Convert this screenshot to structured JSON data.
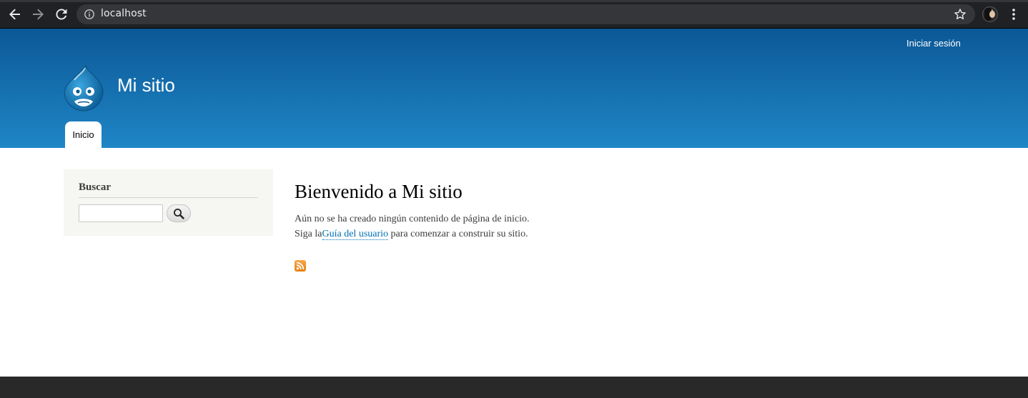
{
  "browser": {
    "url": "localhost",
    "icons": {
      "back": "back-arrow-icon",
      "forward": "forward-arrow-icon",
      "reload": "reload-icon",
      "info": "info-icon",
      "bookmark": "star-icon",
      "menu": "menu-dots-icon"
    }
  },
  "header": {
    "login_label": "Iniciar sesión",
    "site_name": "Mi sitio",
    "logo": "drupal-drop-logo",
    "tabs": [
      {
        "label": "Inicio",
        "active": true
      }
    ],
    "colors": {
      "gradient_top": "#0c5896",
      "gradient_bottom": "#1f86c6"
    }
  },
  "sidebar": {
    "search": {
      "title": "Buscar",
      "input_value": "",
      "button_icon": "magnifier-icon"
    }
  },
  "main": {
    "title": "Bienvenido a Mi sitio",
    "line1": "Aún no se ha creado ningún contenido de página de inicio.",
    "line2_prefix": "Siga la",
    "guide_link": "Guía del usuario",
    "line2_suffix": " para comenzar a construir su sitio.",
    "feed_icon": "rss-feed-icon",
    "link_color": "#0071b3"
  }
}
